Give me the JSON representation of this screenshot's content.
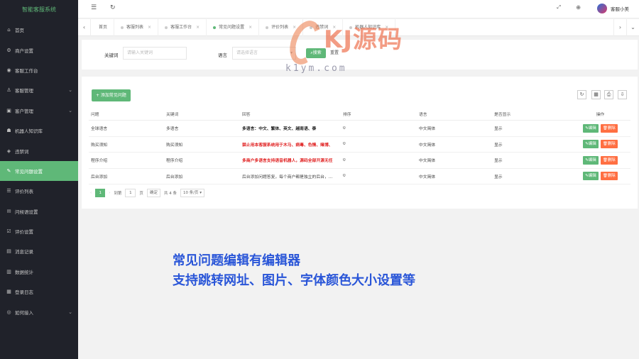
{
  "app": {
    "brand": "智能客服系统"
  },
  "sidebar": {
    "items": [
      {
        "label": "首页",
        "icon": "home-icon",
        "glyph": "⌂",
        "chevron": false,
        "active": false
      },
      {
        "label": "商户设置",
        "icon": "settings-icon",
        "glyph": "⚙",
        "chevron": false,
        "active": false
      },
      {
        "label": "客服工作台",
        "icon": "desk-icon",
        "glyph": "◉",
        "chevron": false,
        "active": false
      },
      {
        "label": "客服管理",
        "icon": "user-icon",
        "glyph": "♙",
        "chevron": true,
        "active": false
      },
      {
        "label": "客户管理",
        "icon": "customer-icon",
        "glyph": "▣",
        "chevron": true,
        "active": false
      },
      {
        "label": "机器人知识库",
        "icon": "robot-icon",
        "glyph": "☗",
        "chevron": false,
        "active": false
      },
      {
        "label": "违禁词",
        "icon": "ban-icon",
        "glyph": "◈",
        "chevron": false,
        "active": false
      },
      {
        "label": "常见问题设置",
        "icon": "faq-icon",
        "glyph": "✎",
        "chevron": false,
        "active": true
      },
      {
        "label": "评价列表",
        "icon": "list-icon",
        "glyph": "☰",
        "chevron": false,
        "active": false
      },
      {
        "label": "问候语设置",
        "icon": "chat-icon",
        "glyph": "✉",
        "chevron": false,
        "active": false
      },
      {
        "label": "评价设置",
        "icon": "rate-icon",
        "glyph": "☑",
        "chevron": false,
        "active": false
      },
      {
        "label": "消息记录",
        "icon": "message-icon",
        "glyph": "▤",
        "chevron": false,
        "active": false
      },
      {
        "label": "数据统计",
        "icon": "stats-icon",
        "glyph": "▥",
        "chevron": false,
        "active": false
      },
      {
        "label": "登录日志",
        "icon": "log-icon",
        "glyph": "▦",
        "chevron": false,
        "active": false
      },
      {
        "label": "如何接入",
        "icon": "link-icon",
        "glyph": "◎",
        "chevron": true,
        "active": false
      }
    ]
  },
  "header": {
    "username": "客服小美"
  },
  "tabs": [
    {
      "label": "首页",
      "closable": false,
      "active": false
    },
    {
      "label": "客服列表",
      "closable": true,
      "active": false
    },
    {
      "label": "客服工作台",
      "closable": true,
      "active": false
    },
    {
      "label": "常见问题设置",
      "closable": true,
      "active": true
    },
    {
      "label": "评价列表",
      "closable": true,
      "active": false
    },
    {
      "label": "违禁词",
      "closable": true,
      "active": false
    },
    {
      "label": "机器人知识库",
      "closable": true,
      "active": false
    }
  ],
  "search": {
    "keyword_label": "关键词",
    "keyword_placeholder": "请输入关键词",
    "lang_label": "语言",
    "lang_placeholder": "请选择语言",
    "search_button": "搜索",
    "reset_button": "重置"
  },
  "table": {
    "add_button": "+ 添加常见问题",
    "columns": [
      "问题",
      "关键词",
      "回答",
      "排序",
      "语言",
      "是否显示",
      "操作"
    ],
    "rows": [
      {
        "q": "全球语言",
        "kw": "多语言",
        "a": "多语言：中文、繁体、英文、越南语、泰",
        "a_style": "bold",
        "sort": "0",
        "lang": "中文简体",
        "show": "显示"
      },
      {
        "q": "购买须知",
        "kw": "购买须知",
        "a": "禁止用本客服系统用于木马、病毒、色情、赌博、",
        "a_style": "red",
        "sort": "0",
        "lang": "中文简体",
        "show": "显示"
      },
      {
        "q": "程序介绍",
        "kw": "程序介绍",
        "a": "多商户多语言支持语音机器人，源码全部开源无任",
        "a_style": "red",
        "sort": "0",
        "lang": "中文简体",
        "show": "显示"
      },
      {
        "q": "后台添加",
        "kw": "后台添加",
        "a": "后台添加问题答复，每个商户都是独立的后台，...",
        "a_style": "normal",
        "sort": "0",
        "lang": "中文简体",
        "show": "显示"
      }
    ],
    "edit_label": "✎编辑",
    "delete_label": "🗑删除"
  },
  "pager": {
    "current": "1",
    "goto_label": "到第",
    "page_input": "1",
    "page_unit": "页",
    "confirm": "确定",
    "total": "共 4 条",
    "per_page": "10 条/页"
  },
  "watermark": {
    "main": "KJ源码",
    "sub": "k1ym.com"
  },
  "caption": {
    "line1": "常见问题编辑有编辑器",
    "line2": "支持跳转网址、图片、字体颜色大小设置等"
  },
  "colors": {
    "sidebar": "#20222a",
    "accent": "#5fb878",
    "danger": "#ff5722",
    "caption": "#2a56d8"
  }
}
